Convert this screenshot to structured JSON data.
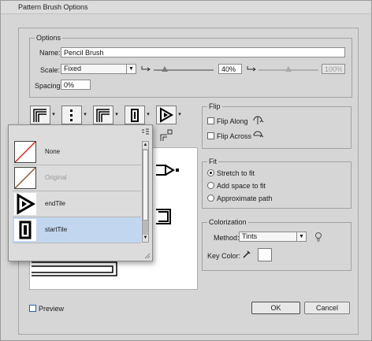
{
  "dialog": {
    "title": "Pattern Brush Options"
  },
  "options": {
    "group_label": "Options",
    "name_label": "Name:",
    "name_value": "Pencil Brush",
    "scale_label": "Scale:",
    "scale_select": "Fixed",
    "scale_value1": "40%",
    "scale_value2": "100%",
    "spacing_label": "Spacing:",
    "spacing_value": "0%"
  },
  "flip": {
    "group_label": "Flip",
    "along": "Flip Along",
    "across": "Flip Across"
  },
  "fit": {
    "group_label": "Fit",
    "stretch": "Stretch to fit",
    "add_space": "Add space to fit",
    "approx": "Approximate path"
  },
  "colorization": {
    "group_label": "Colorization",
    "method_label": "Method:",
    "method_value": "Tints",
    "key_label": "Key Color:"
  },
  "preview": {
    "label": "Preview"
  },
  "buttons": {
    "ok": "OK",
    "cancel": "Cancel"
  },
  "tile_popup": {
    "items": [
      {
        "label": "None"
      },
      {
        "label": "Original"
      },
      {
        "label": "endTile"
      },
      {
        "label": "startTile"
      }
    ],
    "selected_index": 3
  }
}
